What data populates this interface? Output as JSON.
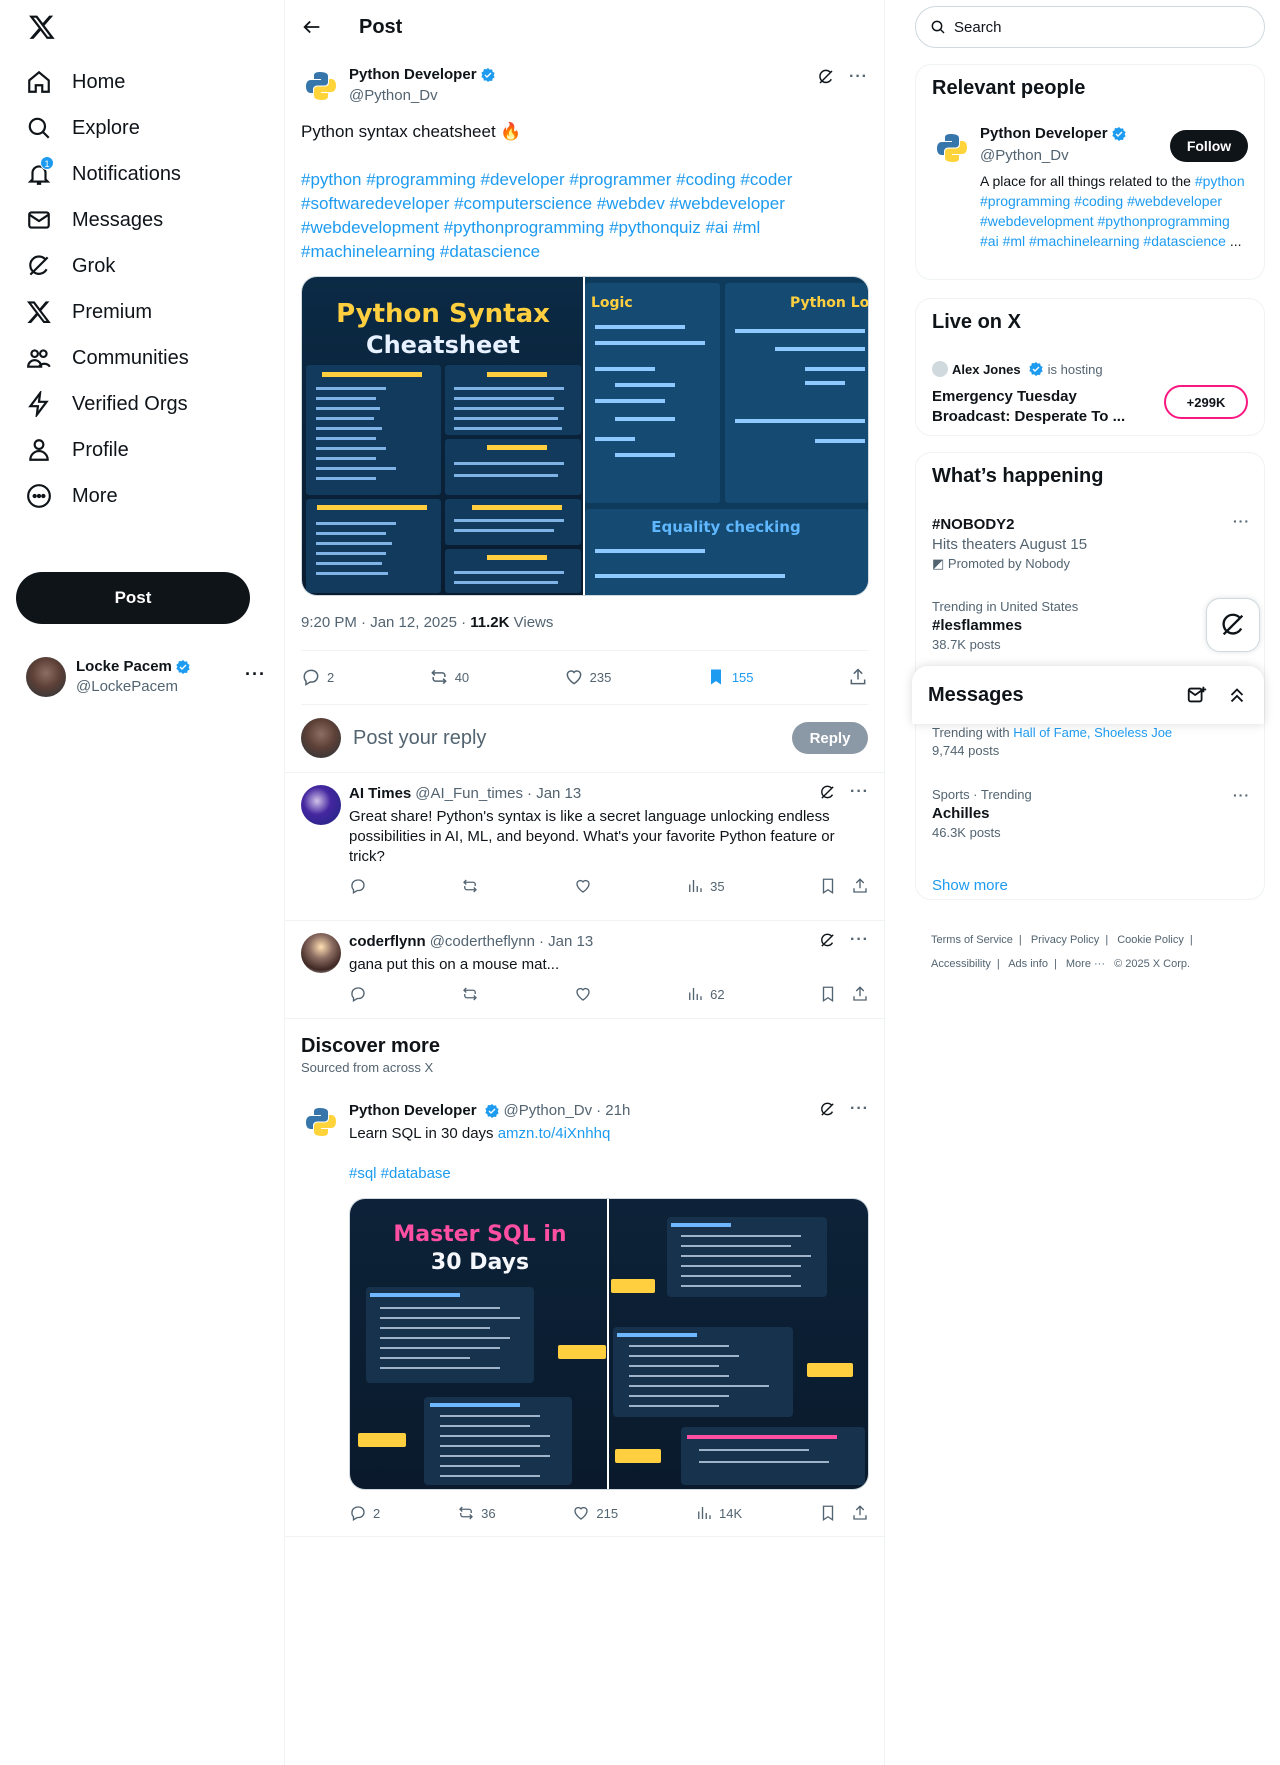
{
  "nav": {
    "items": [
      {
        "label": "Home",
        "icon": "home-icon"
      },
      {
        "label": "Explore",
        "icon": "search-icon"
      },
      {
        "label": "Notifications",
        "icon": "bell-icon",
        "badge": "1"
      },
      {
        "label": "Messages",
        "icon": "envelope-icon"
      },
      {
        "label": "Grok",
        "icon": "grok-icon"
      },
      {
        "label": "Premium",
        "icon": "x-icon"
      },
      {
        "label": "Communities",
        "icon": "communities-icon"
      },
      {
        "label": "Verified Orgs",
        "icon": "lightning-icon"
      },
      {
        "label": "Profile",
        "icon": "person-icon"
      },
      {
        "label": "More",
        "icon": "more-circle-icon"
      }
    ],
    "post_button": "Post",
    "account": {
      "name": "Locke Pacem",
      "handle": "@LockePacem"
    }
  },
  "header": {
    "title": "Post"
  },
  "post": {
    "author": "Python Developer",
    "handle": "@Python_Dv",
    "text": "Python syntax cheatsheet 🔥",
    "hashtags": "#python #programming #developer #programmer #coding #coder #softwaredeveloper #computerscience #webdev #webdeveloper #webdevelopment #pythonprogramming #pythonquiz #ai #ml #machinelearning #datascience",
    "image_left_title_1": "Python Syntax",
    "image_left_title_2": "Cheatsheet",
    "image_right_logic": "Logic",
    "image_right_loops": "Python Loo",
    "image_right_equality": "Equality checking",
    "time": "9:20 PM · Jan 12, 2025 · ",
    "views": "11.2K",
    "views_label": " Views",
    "stats": {
      "replies": "2",
      "reposts": "40",
      "likes": "235",
      "bookmarks": "155"
    }
  },
  "reply_box": {
    "placeholder": "Post your reply",
    "button": "Reply"
  },
  "replies": [
    {
      "name": "AI Times",
      "handle": "@AI_Fun_times",
      "date": "· Jan 13",
      "text": "Great share! Python's syntax is like a secret language unlocking endless possibilities in AI, ML, and beyond. What's your favorite Python feature or trick?",
      "views": "35"
    },
    {
      "name": "coderflynn",
      "handle": "@codertheflynn",
      "date": "· Jan 13",
      "text": "gana put this on a mouse mat...",
      "views": "62"
    }
  ],
  "discover": {
    "title": "Discover more",
    "subtitle": "Sourced from across X"
  },
  "discover_post": {
    "name": "Python Developer",
    "handle": "@Python_Dv",
    "date": "· 21h",
    "text": "Learn SQL in 30 days ",
    "link": "amzn.to/4iXnhhq",
    "tags": "#sql #database",
    "img_title_1": "Master SQL in",
    "img_title_2": "30 Days",
    "replies": "2",
    "reposts": "36",
    "likes": "215",
    "views": "14K"
  },
  "search": {
    "placeholder": "Search"
  },
  "relevant": {
    "title": "Relevant people",
    "name": "Python Developer",
    "handle": "@Python_Dv",
    "follow": "Follow",
    "bio_text": "A place for all things related to the ",
    "bio_tags": "#python #programming #coding #webdeveloper #webdevelopment #pythonprogramming #ai #ml #machinelearning #datascience",
    "bio_ellipsis": " ..."
  },
  "live": {
    "title": "Live on X",
    "host": "Alex Jones",
    "hosting": "is hosting",
    "event": "Emergency Tuesday Broadcast: Desperate To ...",
    "count": "+299K"
  },
  "happening": {
    "title": "What’s happening",
    "trends": [
      {
        "meta": "",
        "title": "#NOBODY2",
        "count": "Hits theaters August 15",
        "promo": "Promoted by Nobody"
      },
      {
        "meta": "Trending in United States",
        "title": "#lesflammes",
        "count": "38.7K posts"
      },
      {
        "meta": "Trending with",
        "with": "Hall of Fame, Shoeless Joe",
        "count": "9,744 posts"
      },
      {
        "meta": "Sports · Trending",
        "title": "Achilles",
        "count": "46.3K posts"
      }
    ],
    "show_more": "Show more"
  },
  "messages_drawer": {
    "title": "Messages"
  },
  "footer": {
    "links": [
      "Terms of Service",
      "|",
      "Privacy Policy",
      "|",
      "Cookie Policy",
      "|",
      "Accessibility",
      "|",
      "Ads info",
      "|",
      "More ···",
      "© 2025 X Corp."
    ]
  },
  "colors": {
    "accent": "#1d9bf0",
    "text": "#0f1419",
    "muted": "#536471",
    "live": "#f91880"
  }
}
